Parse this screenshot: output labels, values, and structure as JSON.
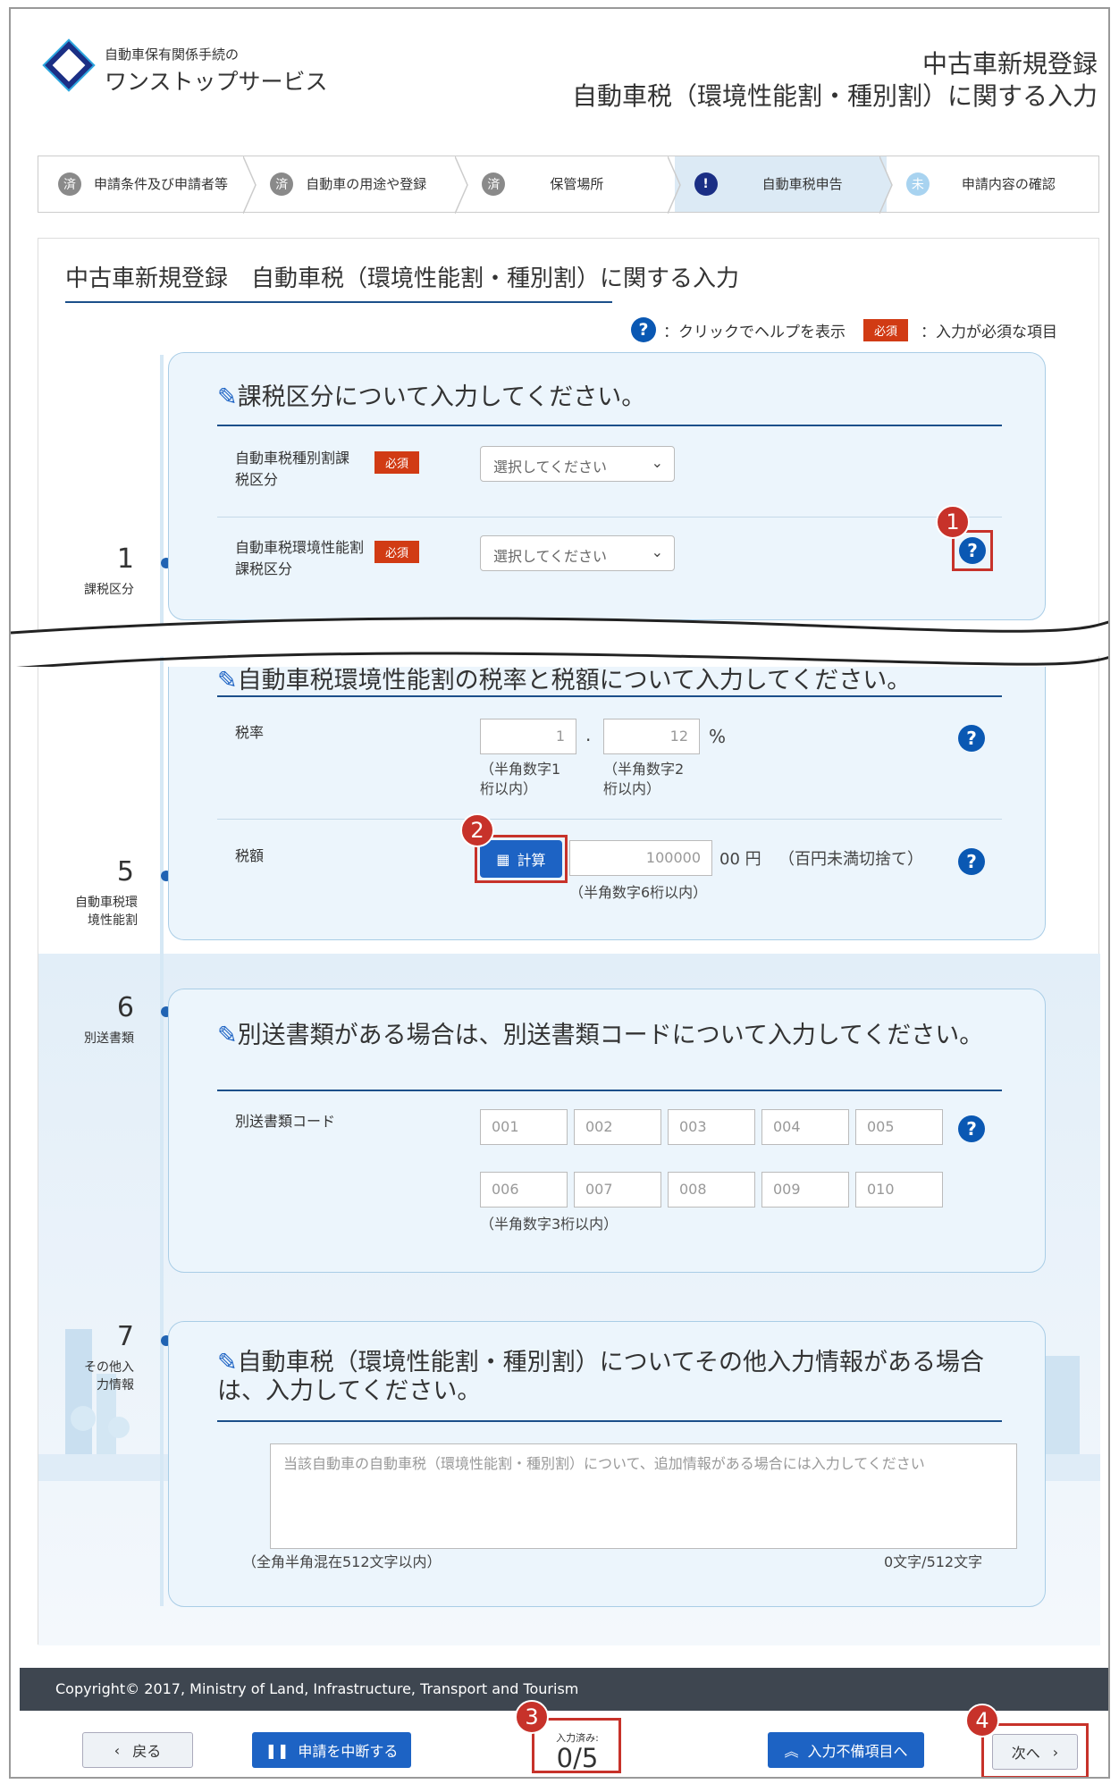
{
  "header": {
    "logo_line1": "自動車保有関係手続の",
    "logo_line2": "ワンストップサービス",
    "title1": "中古車新規登録",
    "title2": "自動車税（環境性能割・種別割）に関する入力"
  },
  "steps": [
    {
      "mark": "済",
      "label": "申請条件及び申請者等",
      "state": "done"
    },
    {
      "mark": "済",
      "label": "自動車の用途や登録",
      "state": "done"
    },
    {
      "mark": "済",
      "label": "保管場所",
      "state": "done"
    },
    {
      "mark": "!",
      "label": "自動車税申告",
      "state": "active"
    },
    {
      "mark": "未",
      "label": "申請内容の確認",
      "state": "todo"
    }
  ],
  "page_title": "中古車新規登録　自動車税（環境性能割・種別割）に関する入力",
  "legend": {
    "help_text": "：クリックでヘルプを表示",
    "required_badge": "必須",
    "required_text": "：入力が必須な項目"
  },
  "timeline": [
    {
      "num": "1",
      "label": "課税区分"
    },
    {
      "num": "5",
      "label": "自動車税環境性能割"
    },
    {
      "num": "6",
      "label": "別送書類"
    },
    {
      "num": "7",
      "label": "その他入力情報"
    }
  ],
  "section1": {
    "title": "課税区分について入力してください。",
    "field1_label": "自動車税種別割課税区分",
    "field1_value": "選択してください",
    "field2_label": "自動車税環境性能割課税区分",
    "field2_value": "選択してください",
    "required": "必須"
  },
  "section5": {
    "title": "自動車税環境性能割の税率と税額について入力してください。",
    "rate_label": "税率",
    "rate_int": "1",
    "rate_dec": "12",
    "dot": ".",
    "percent": "%",
    "hint_int": "（半角数字1桁以内）",
    "hint_dec": "（半角数字2桁以内）",
    "amount_label": "税額",
    "calc_button": "計算",
    "amount_value": "100000",
    "amount_suffix": "00 円",
    "amount_note": "（百円未満切捨て）",
    "amount_hint": "（半角数字6桁以内）"
  },
  "section6": {
    "title": "別送書類がある場合は、別送書類コードについて入力してください。",
    "code_label": "別送書類コード",
    "codes": [
      "001",
      "002",
      "003",
      "004",
      "005",
      "006",
      "007",
      "008",
      "009",
      "010"
    ],
    "hint": "（半角数字3桁以内）"
  },
  "section7": {
    "title": "自動車税（環境性能割・種別割）についてその他入力情報がある場合は、入力してください。",
    "placeholder": "当該自動車の自動車税（環境性能割・種別割）について、追加情報がある場合には入力してください",
    "hint": "（全角半角混在512文字以内）",
    "char_count": "0文字/512文字"
  },
  "callouts": [
    "1",
    "2",
    "3",
    "4"
  ],
  "footer": {
    "copyright": "Copyright© 2017, Ministry of Land, Infrastructure, Transport and Tourism",
    "back": "戻る",
    "suspend": "申請を中断する",
    "counter_label": "入力済み:",
    "counter_value": "0/5",
    "incomplete": "入力不備項目へ",
    "next": "次へ"
  },
  "colors": {
    "accent": "#1d63c4",
    "required": "#d13b14",
    "callout": "#c7322a"
  }
}
